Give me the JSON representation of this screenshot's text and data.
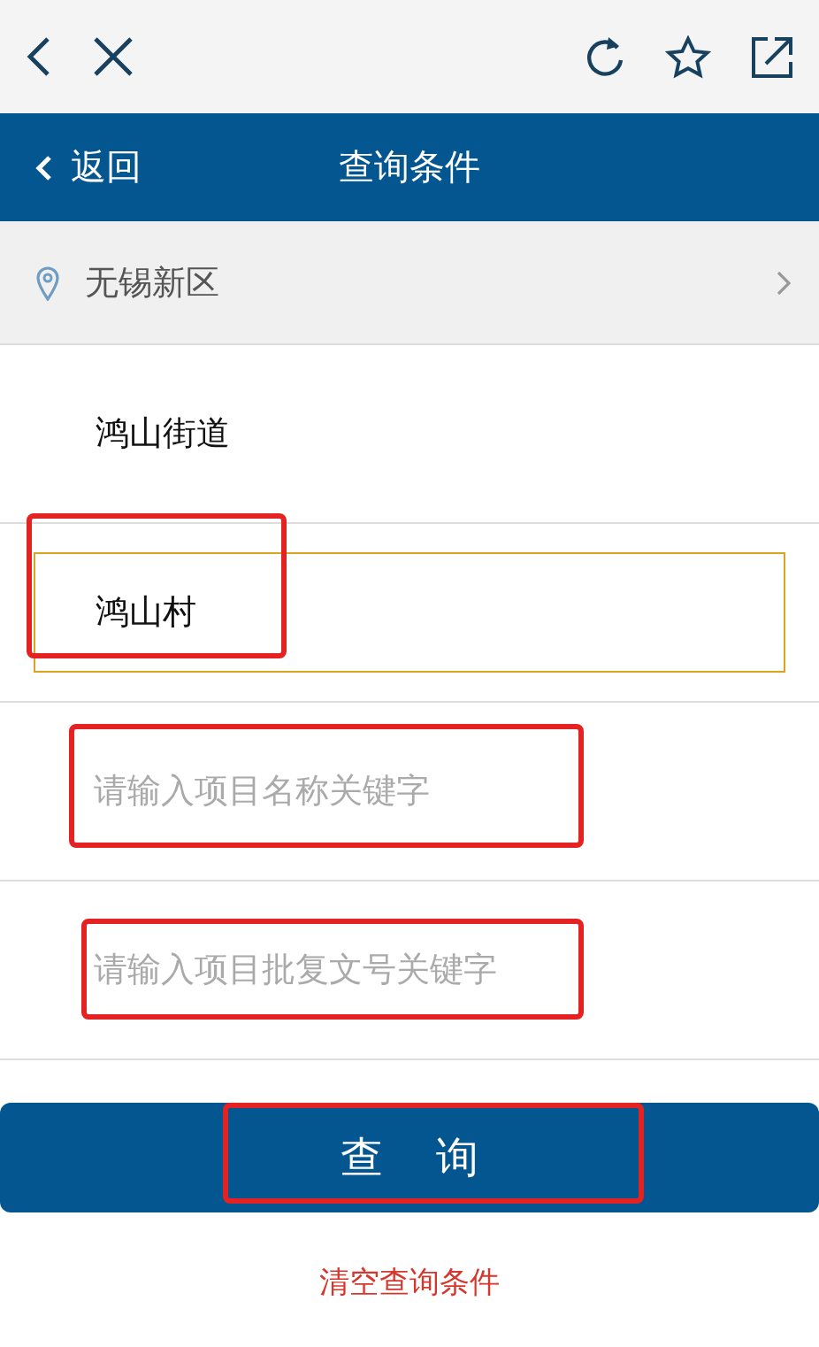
{
  "header": {
    "back_label": "返回",
    "title": "查询条件"
  },
  "location": {
    "label": "无锡新区"
  },
  "options": [
    {
      "label": "鸿山街道",
      "selected": false,
      "highlighted": false
    },
    {
      "label": "鸿山村",
      "selected": true,
      "highlighted": true
    }
  ],
  "fields": [
    {
      "placeholder": "请输入项目名称关键字",
      "highlighted": true
    },
    {
      "placeholder": "请输入项目批复文号关键字",
      "highlighted": true
    }
  ],
  "search_button": {
    "label": "查 询",
    "highlighted": true
  },
  "clear_link": {
    "label": "清空查询条件"
  }
}
